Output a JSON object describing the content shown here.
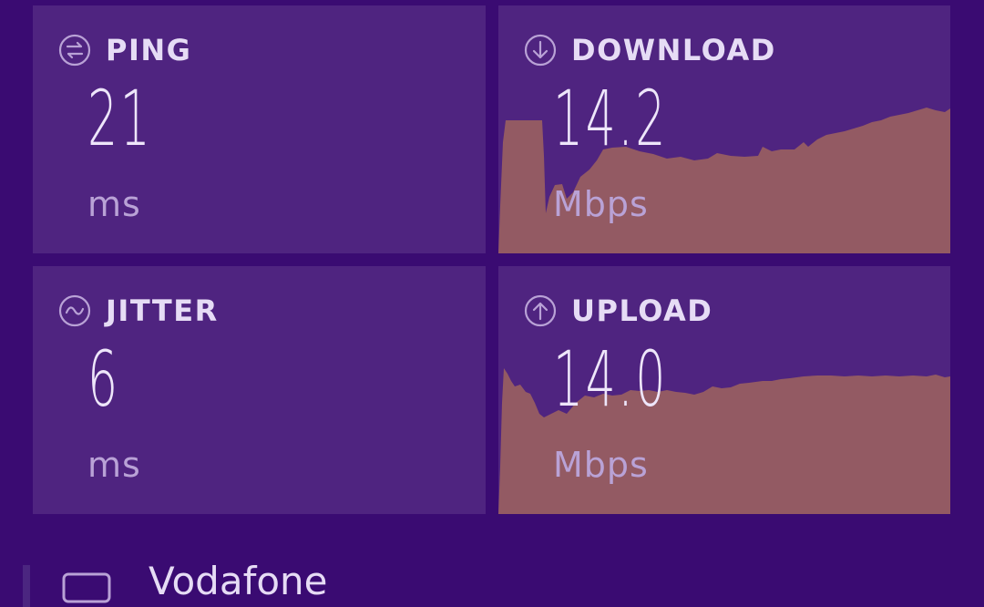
{
  "colors": {
    "background": "#3a0b72",
    "card": "#4f2480",
    "chart_fill": "#935a63",
    "text": "#e6dcf5",
    "unit_text": "#b9a2d6"
  },
  "ping": {
    "label": "PING",
    "value": "21",
    "unit": "ms",
    "icon": "ping-icon"
  },
  "download": {
    "label": "DOWNLOAD",
    "value": "14.2",
    "unit": "Mbps",
    "icon": "download-arrow-icon"
  },
  "jitter": {
    "label": "JITTER",
    "value": "6",
    "unit": "ms",
    "icon": "jitter-wave-icon"
  },
  "upload": {
    "label": "UPLOAD",
    "value": "14.0",
    "unit": "Mbps",
    "icon": "upload-arrow-icon"
  },
  "provider": {
    "name": "Vodafone",
    "icon": "device-icon"
  }
}
